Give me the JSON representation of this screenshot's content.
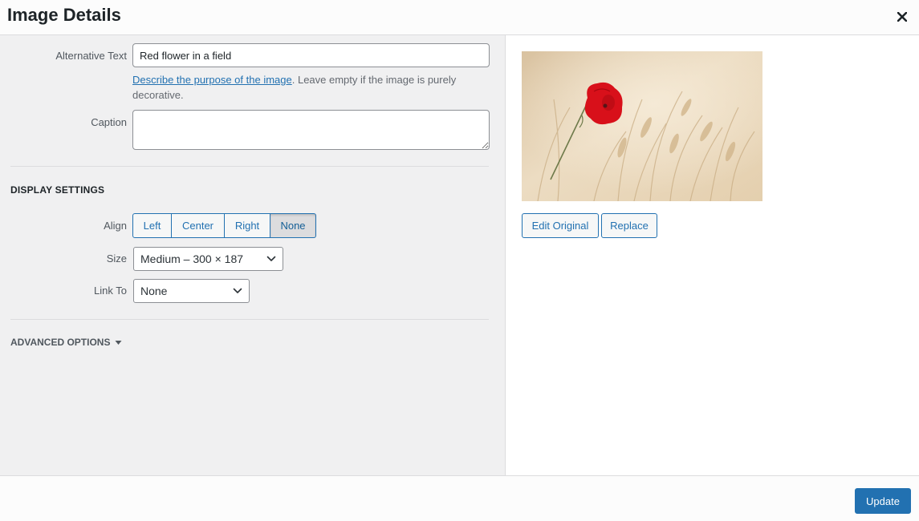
{
  "header": {
    "title": "Image Details",
    "close_icon": "close-icon"
  },
  "details": {
    "alt_label": "Alternative Text",
    "alt_value": "Red flower in a field",
    "help_link": "Describe the purpose of the image",
    "help_rest": ". Leave empty if the image is purely decorative.",
    "caption_label": "Caption",
    "caption_value": ""
  },
  "display": {
    "heading": "Display Settings",
    "align_label": "Align",
    "align_options": [
      "Left",
      "Center",
      "Right",
      "None"
    ],
    "align_selected": "None",
    "size_label": "Size",
    "size_value": "Medium – 300 × 187",
    "link_label": "Link To",
    "link_value": "None"
  },
  "advanced": {
    "label": "Advanced Options"
  },
  "image": {
    "edit_label": "Edit Original",
    "replace_label": "Replace",
    "colors": {
      "background": "#e6d5bb",
      "flower": "#d8101a"
    }
  },
  "footer": {
    "update_label": "Update"
  },
  "colors": {
    "accent": "#2271b1",
    "panel": "#f0f0f1"
  }
}
